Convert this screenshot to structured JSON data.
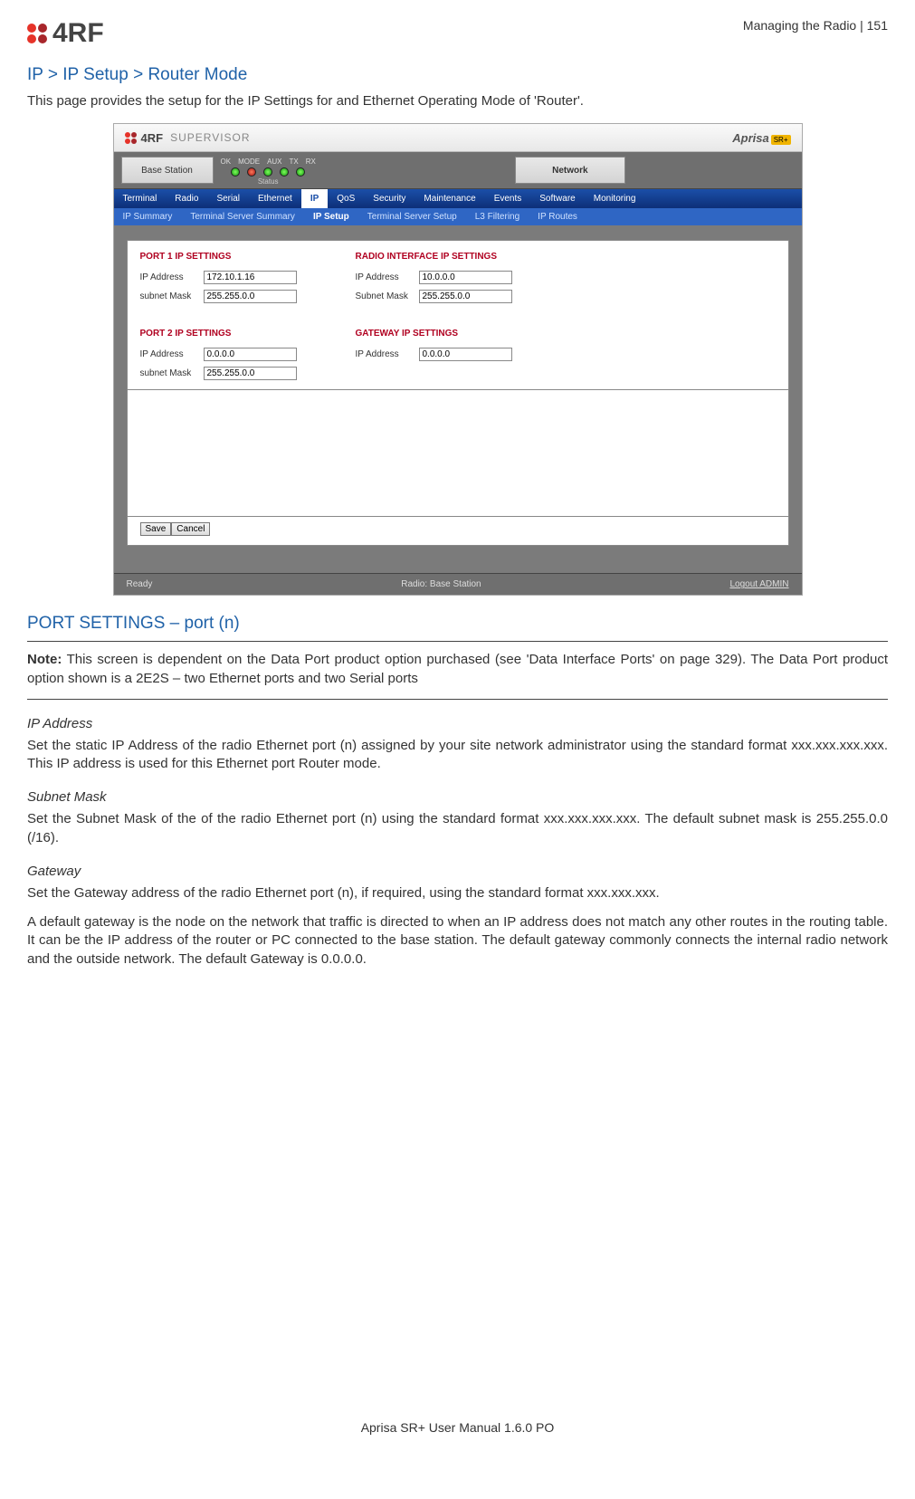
{
  "header": {
    "logo_text": "4RF",
    "meta": "Managing the Radio  |  151"
  },
  "title": "IP > IP Setup > Router Mode",
  "intro": "This page provides the setup for the IP Settings for and Ethernet Operating Mode of 'Router'.",
  "screenshot": {
    "supervisor_label": "SUPERVISOR",
    "brand_a": "Aprisa",
    "brand_sr": "SR+",
    "base_station": "Base Station",
    "status_caption": "Status",
    "led_labels": [
      "OK",
      "MODE",
      "AUX",
      "TX",
      "RX"
    ],
    "network_label": "Network",
    "tabs1": [
      "Terminal",
      "Radio",
      "Serial",
      "Ethernet",
      "IP",
      "QoS",
      "Security",
      "Maintenance",
      "Events",
      "Software",
      "Monitoring"
    ],
    "tabs1_active": "IP",
    "tabs2": [
      "IP Summary",
      "Terminal Server Summary",
      "IP Setup",
      "Terminal Server Setup",
      "L3 Filtering",
      "IP Routes"
    ],
    "tabs2_active": "IP Setup",
    "port1": {
      "title": "PORT 1 IP SETTINGS",
      "ip_label": "IP Address",
      "ip_value": "172.10.1.16",
      "mask_label": "subnet Mask",
      "mask_value": "255.255.0.0"
    },
    "port2": {
      "title": "PORT 2 IP SETTINGS",
      "ip_label": "IP Address",
      "ip_value": "0.0.0.0",
      "mask_label": "subnet Mask",
      "mask_value": "255.255.0.0"
    },
    "radioif": {
      "title": "RADIO INTERFACE IP SETTINGS",
      "ip_label": "IP Address",
      "ip_value": "10.0.0.0",
      "mask_label": "Subnet Mask",
      "mask_value": "255.255.0.0"
    },
    "gateway": {
      "title": "GATEWAY IP SETTINGS",
      "ip_label": "IP Address",
      "ip_value": "0.0.0.0"
    },
    "save_btn": "Save",
    "cancel_btn": "Cancel",
    "footer_ready": "Ready",
    "footer_radio": "Radio: Base Station",
    "footer_logout": "Logout ADMIN"
  },
  "section2_title": "PORT SETTINGS – port (n)",
  "note_label": "Note:",
  "note_text": " This screen is dependent on the Data Port product option purchased (see 'Data Interface Ports' on page 329). The Data Port product option shown is a 2E2S – two Ethernet ports and two Serial ports",
  "ipaddr_h": "IP Address",
  "ipaddr_p": "Set the static IP Address of the radio Ethernet port (n) assigned by your site network administrator using the standard format xxx.xxx.xxx.xxx. This IP address is used for this Ethernet port Router mode.",
  "subnet_h": "Subnet Mask",
  "subnet_p": "Set the Subnet Mask of the of the radio Ethernet port (n) using the standard format xxx.xxx.xxx.xxx. The default subnet mask is 255.255.0.0 (/16).",
  "gateway_h": "Gateway",
  "gateway_p1": "Set the Gateway address of the radio Ethernet port (n), if required, using the standard format xxx.xxx.xxx.",
  "gateway_p2": "A default gateway is the node on the network that traffic is directed to when an IP address does not match any other routes in the routing table. It can be the IP address of the router or PC connected to the base station. The default gateway commonly connects the internal radio network and the outside network. The default Gateway is 0.0.0.0.",
  "footer": "Aprisa SR+ User Manual 1.6.0 PO"
}
